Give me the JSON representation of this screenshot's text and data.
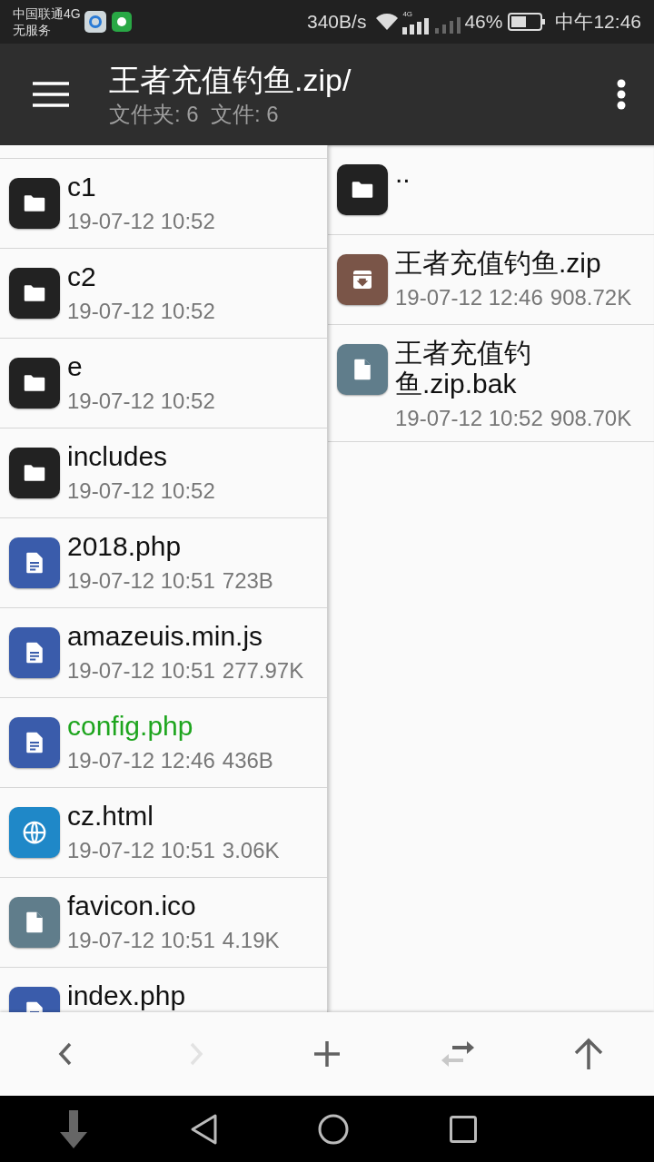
{
  "status_bar": {
    "carrier": "中国联通4G",
    "service": "无服务",
    "speed": "340B/s",
    "network": "4G",
    "battery": "46%",
    "time": "中午12:46"
  },
  "header": {
    "title": "王者充值钓鱼.zip/",
    "subtitle": "文件夹: 6  文件: 6"
  },
  "left_pane": {
    "items": [
      {
        "kind": "folder",
        "name": "c1",
        "date": "19-07-12 10:52",
        "highlighted": false
      },
      {
        "kind": "folder",
        "name": "c2",
        "date": "19-07-12 10:52",
        "highlighted": false
      },
      {
        "kind": "folder",
        "name": "e",
        "date": "19-07-12 10:52",
        "highlighted": false
      },
      {
        "kind": "folder",
        "name": "includes",
        "date": "19-07-12 10:52",
        "highlighted": false
      },
      {
        "kind": "document",
        "name": "2018.php",
        "date": "19-07-12 10:51",
        "size": "723B",
        "highlighted": false
      },
      {
        "kind": "document",
        "name": "amazeuis.min.js",
        "date": "19-07-12 10:51",
        "size": "277.97K",
        "highlighted": false
      },
      {
        "kind": "document",
        "name": "config.php",
        "date": "19-07-12 12:46",
        "size": "436B",
        "highlighted": true
      },
      {
        "kind": "web",
        "name": "cz.html",
        "date": "19-07-12 10:51",
        "size": "3.06K",
        "highlighted": false
      },
      {
        "kind": "file",
        "name": "favicon.ico",
        "date": "19-07-12 10:51",
        "size": "4.19K",
        "highlighted": false
      },
      {
        "kind": "document",
        "name": "index.php",
        "highlighted": false
      }
    ]
  },
  "right_pane": {
    "items": [
      {
        "kind": "folder",
        "name": "..",
        "highlighted": false
      },
      {
        "kind": "archive",
        "name": "王者充值钓鱼.zip",
        "date": "19-07-12 12:46",
        "size": "908.72K",
        "highlighted": false
      },
      {
        "kind": "file",
        "name": "王者充值钓鱼.zip.bak",
        "date": "19-07-12 10:52",
        "size": "908.70K",
        "highlighted": false
      }
    ]
  },
  "toolbar": [
    {
      "kind": "back",
      "disabled": false
    },
    {
      "kind": "forward",
      "disabled": true
    },
    {
      "kind": "add",
      "disabled": false
    },
    {
      "kind": "swap",
      "disabled": false
    },
    {
      "kind": "up",
      "disabled": false
    }
  ]
}
